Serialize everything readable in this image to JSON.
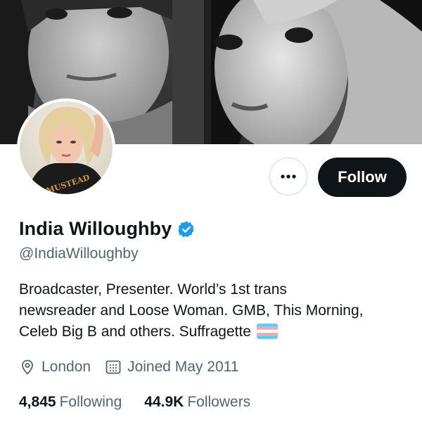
{
  "profile": {
    "display_name": "India Willoughby",
    "handle": "@IndiaWilloughby",
    "verified": true,
    "bio_lines": [
      "Broadcaster, Presenter. World’s 1st trans",
      "newsreader and Loose Woman. GMB, This Morning,",
      "Celeb Big B and others. Suffragette"
    ],
    "location": "London",
    "joined": "Joined May 2011",
    "avatar_shirt_text": "MUSTEAD"
  },
  "actions": {
    "follow_label": "Follow"
  },
  "stats": {
    "following_count": "4,845",
    "following_label": "Following",
    "followers_count": "44.9K",
    "followers_label": "Followers"
  },
  "icons": {
    "more": "more-icon",
    "verified": "verified-badge-icon",
    "location": "location-pin-icon",
    "calendar": "calendar-icon",
    "flag": "trans-flag-emoji"
  },
  "colors": {
    "text_primary": "#0f1419",
    "text_secondary": "#536471",
    "verified_blue": "#1d9bf0",
    "follow_button_bg": "#0f1419"
  }
}
